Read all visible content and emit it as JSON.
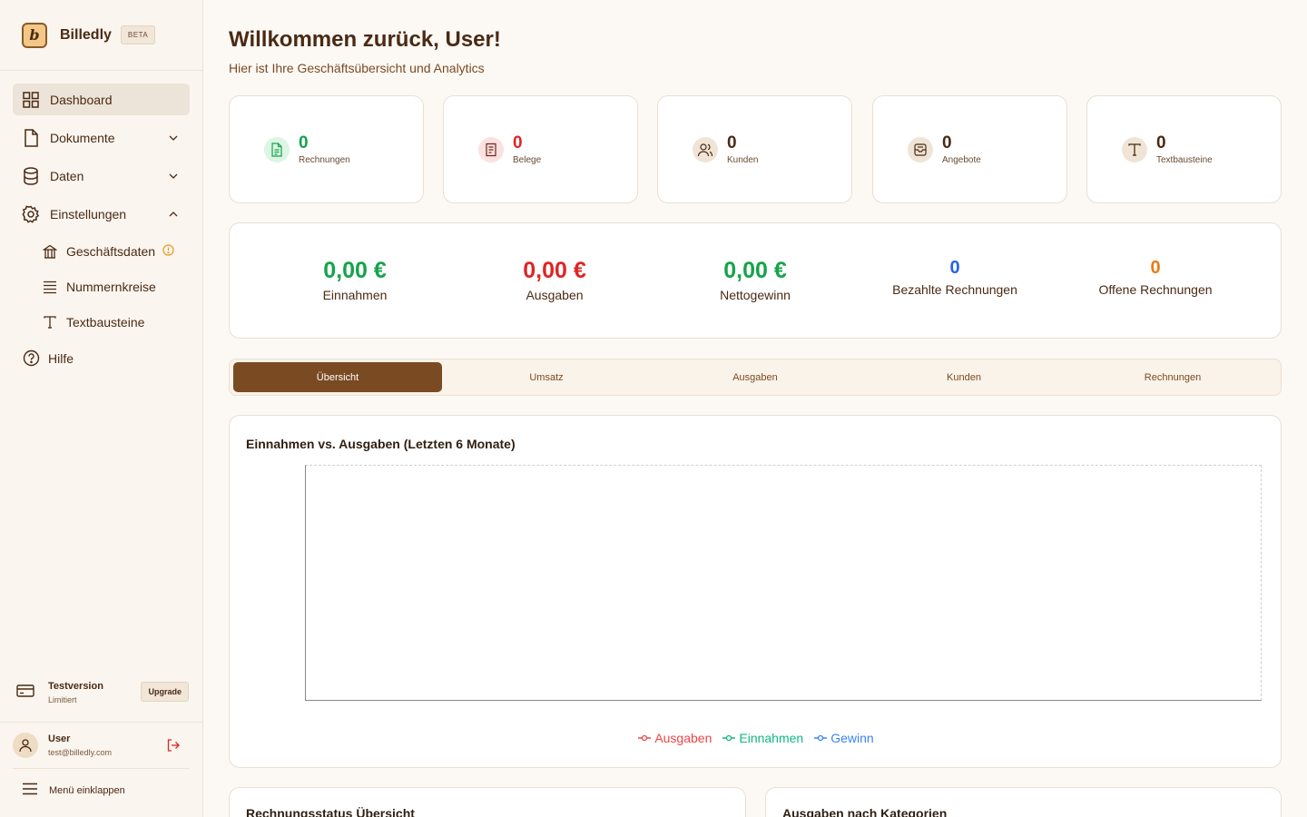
{
  "brand": {
    "name": "Billedly",
    "logo_letter": "b",
    "badge": "BETA"
  },
  "sidebar": {
    "items": [
      {
        "label": "Dashboard",
        "icon": "grid-icon"
      },
      {
        "label": "Dokumente",
        "icon": "file-icon"
      },
      {
        "label": "Daten",
        "icon": "database-icon"
      },
      {
        "label": "Einstellungen",
        "icon": "gear-icon"
      }
    ],
    "subitems": [
      {
        "label": "Geschäftsdaten",
        "icon": "bank-icon"
      },
      {
        "label": "Nummernkreise",
        "icon": "list-icon"
      },
      {
        "label": "Textbausteine",
        "icon": "type-icon"
      }
    ],
    "help": {
      "label": "Hilfe",
      "icon": "help-icon"
    },
    "trial": {
      "title": "Testversion",
      "subtitle": "Limitiert",
      "upgrade": "Upgrade"
    },
    "user": {
      "name": "User",
      "email": "test@billedly.com"
    },
    "collapse": "Menü einklappen"
  },
  "header": {
    "title": "Willkommen zurück, User!",
    "subtitle": "Hier ist Ihre Geschäftsübersicht und Analytics"
  },
  "stats": [
    {
      "value": "0",
      "label": "Rechnungen",
      "color": "#16a34a"
    },
    {
      "value": "0",
      "label": "Belege",
      "color": "#dc2626"
    },
    {
      "value": "0",
      "label": "Kunden",
      "color": "#4a2a14"
    },
    {
      "value": "0",
      "label": "Angebote",
      "color": "#4a2a14"
    },
    {
      "value": "0",
      "label": "Textbausteine",
      "color": "#4a2a14"
    }
  ],
  "kpis": [
    {
      "value": "0,00 €",
      "label": "Einnahmen",
      "color": "#16a34a"
    },
    {
      "value": "0,00 €",
      "label": "Ausgaben",
      "color": "#dc2626"
    },
    {
      "value": "0,00 €",
      "label": "Nettogewinn",
      "color": "#16a34a"
    },
    {
      "value": "0",
      "label": "Bezahlte Rechnungen",
      "color": "#2563eb"
    },
    {
      "value": "0",
      "label": "Offene Rechnungen",
      "color": "#ea7a12"
    }
  ],
  "tabs": [
    "Übersicht",
    "Umsatz",
    "Ausgaben",
    "Kunden",
    "Rechnungen"
  ],
  "chart_data": {
    "type": "line",
    "title": "Einnahmen vs. Ausgaben (Letzten 6 Monate)",
    "series": [
      {
        "name": "Ausgaben",
        "values": [],
        "color": "#ef4444"
      },
      {
        "name": "Einnahmen",
        "values": [],
        "color": "#10b981"
      },
      {
        "name": "Gewinn",
        "values": [],
        "color": "#3b82f6"
      }
    ],
    "legend": "bottom"
  },
  "bottom": {
    "left_title": "Rechnungsstatus Übersicht",
    "right_title": "Ausgaben nach Kategorien"
  }
}
